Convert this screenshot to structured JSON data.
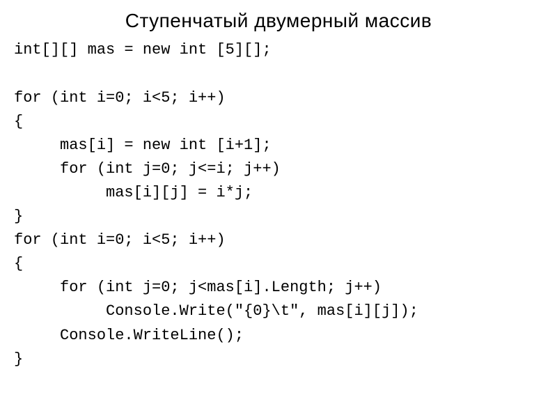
{
  "title": "Ступенчатый двумерный массив",
  "code_lines": [
    "int[][] mas = new int [5][];",
    "",
    "for (int i=0; i<5; i++)",
    "{",
    "     mas[i] = new int [i+1];",
    "     for (int j=0; j<=i; j++)",
    "          mas[i][j] = i*j;",
    "}",
    "for (int i=0; i<5; i++)",
    "{",
    "     for (int j=0; j<mas[i].Length; j++)",
    "          Console.Write(\"{0}\\t\", mas[i][j]);",
    "     Console.WriteLine();",
    "}"
  ]
}
